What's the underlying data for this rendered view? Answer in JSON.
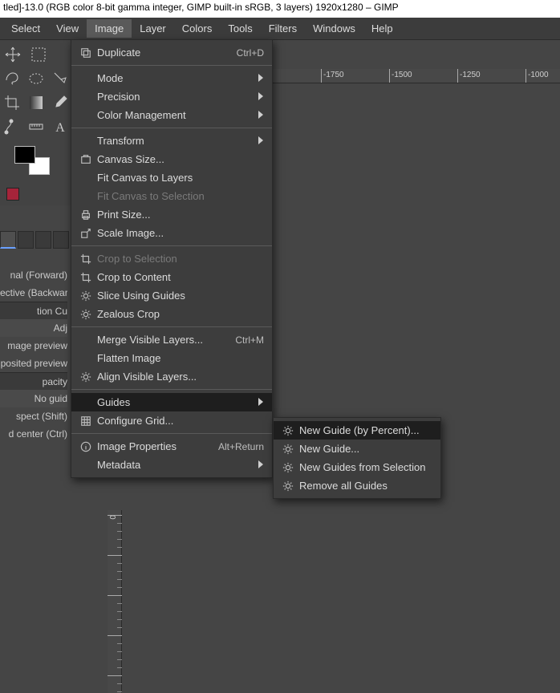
{
  "window": {
    "title": "tled]-13.0 (RGB color 8-bit gamma integer, GIMP built-in sRGB, 3 layers) 1920x1280 – GIMP"
  },
  "menubar": {
    "items": [
      "Select",
      "View",
      "Image",
      "Layer",
      "Colors",
      "Tools",
      "Filters",
      "Windows",
      "Help"
    ],
    "active_index": 2
  },
  "image_menu": {
    "items": [
      {
        "label": "Duplicate",
        "accel": "Ctrl+D",
        "icon": "duplicate"
      },
      {
        "sep": true
      },
      {
        "label": "Mode",
        "submenu": true
      },
      {
        "label": "Precision",
        "submenu": true
      },
      {
        "label": "Color Management",
        "submenu": true
      },
      {
        "sep": true
      },
      {
        "label": "Transform",
        "submenu": true
      },
      {
        "label": "Canvas Size...",
        "icon": "canvas"
      },
      {
        "label": "Fit Canvas to Layers"
      },
      {
        "label": "Fit Canvas to Selection",
        "disabled": true
      },
      {
        "label": "Print Size...",
        "icon": "print"
      },
      {
        "label": "Scale Image...",
        "icon": "scale"
      },
      {
        "sep": true
      },
      {
        "label": "Crop to Selection",
        "icon": "crop",
        "disabled": true
      },
      {
        "label": "Crop to Content",
        "icon": "crop"
      },
      {
        "label": "Slice Using Guides",
        "icon": "gear"
      },
      {
        "label": "Zealous Crop",
        "icon": "gear"
      },
      {
        "sep": true
      },
      {
        "label": "Merge Visible Layers...",
        "accel": "Ctrl+M"
      },
      {
        "label": "Flatten Image"
      },
      {
        "label": "Align Visible Layers...",
        "icon": "gear"
      },
      {
        "sep": true
      },
      {
        "label": "Guides",
        "submenu": true,
        "highlight": true
      },
      {
        "label": "Configure Grid...",
        "icon": "grid"
      },
      {
        "sep": true
      },
      {
        "label": "Image Properties",
        "accel": "Alt+Return",
        "icon": "info"
      },
      {
        "label": "Metadata",
        "submenu": true
      }
    ]
  },
  "guides_submenu": {
    "items": [
      {
        "label": "New Guide (by Percent)...",
        "icon": "gear",
        "highlight": true
      },
      {
        "label": "New Guide...",
        "icon": "gear"
      },
      {
        "label": "New Guides from Selection",
        "icon": "gear"
      },
      {
        "label": "Remove all Guides",
        "icon": "gear"
      }
    ]
  },
  "side_panel": {
    "rows": [
      "nal (Forward)",
      "ective (Backward)",
      "tion                     Cu",
      "                         Adj",
      "mage preview",
      "posited preview",
      "pacity",
      "No guid",
      "spect (Shift)",
      "d center (Ctrl)"
    ]
  },
  "ruler_h": {
    "ticks": [
      {
        "label": "-1750",
        "pos": 60
      },
      {
        "label": "-1500",
        "pos": 145
      },
      {
        "label": "-1250",
        "pos": 230
      },
      {
        "label": "-1000",
        "pos": 315
      }
    ]
  },
  "ruler_v": {
    "labels": [
      "0"
    ]
  }
}
